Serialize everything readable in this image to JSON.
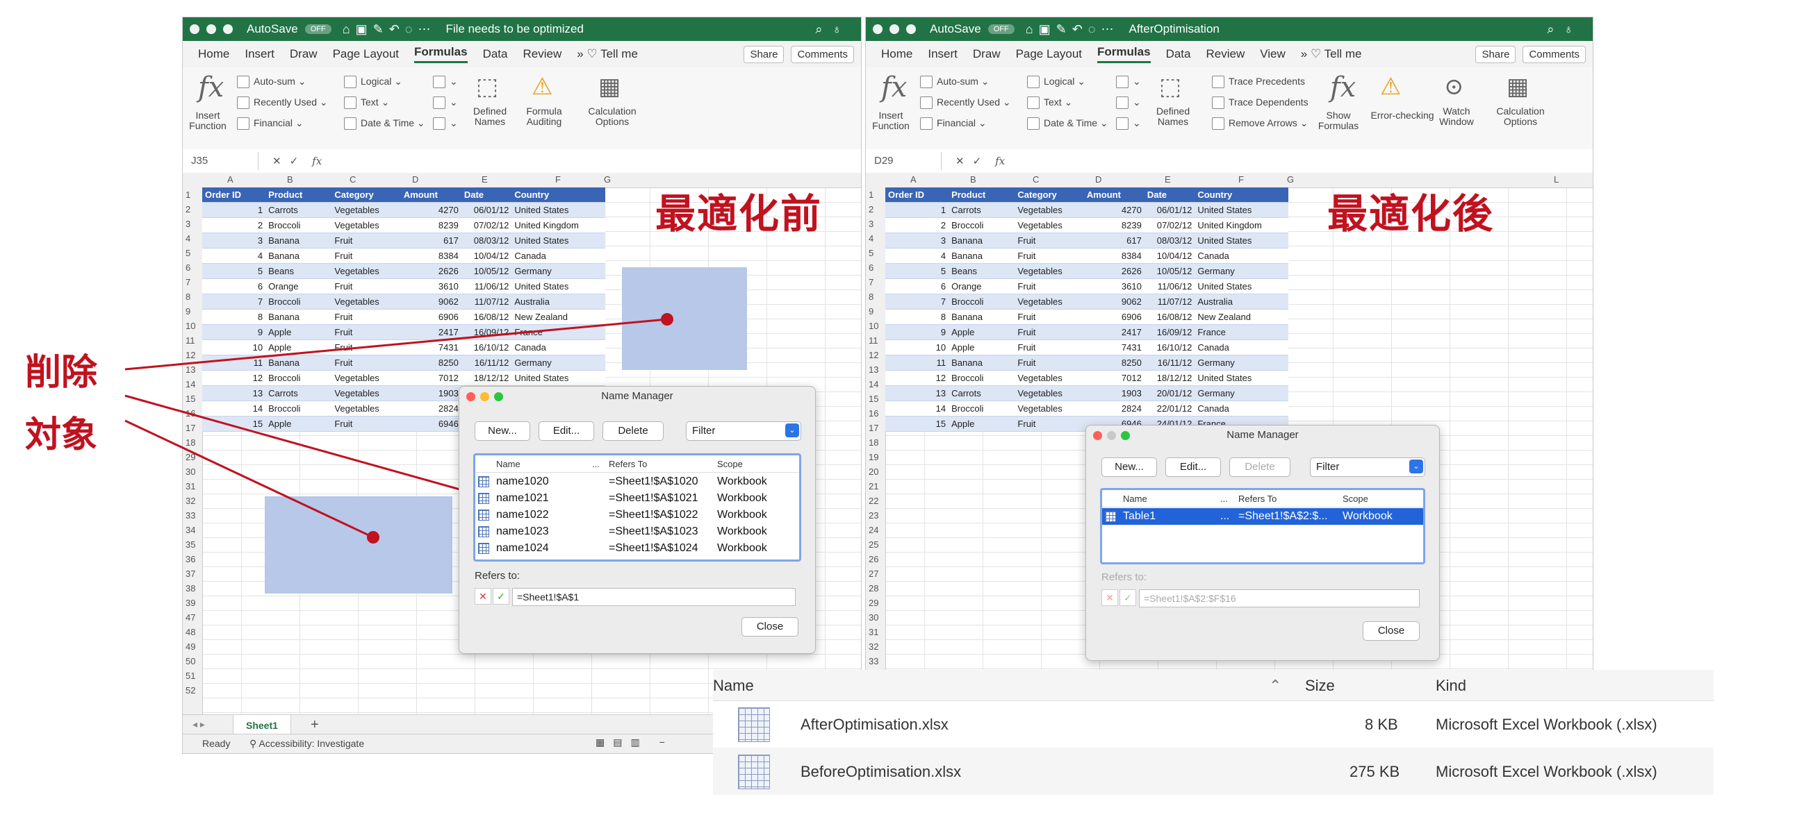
{
  "left_window": {
    "autosave_label": "AutoSave",
    "autosave_state": "OFF",
    "doc_title": "File needs to be optimized",
    "menu": [
      "Home",
      "Insert",
      "Draw",
      "Page Layout",
      "Formulas",
      "Data",
      "Review"
    ],
    "tell_me": "Tell me",
    "share": "Share",
    "comments": "Comments",
    "name_box": "J35",
    "section_label": "最適化前"
  },
  "right_window": {
    "autosave_label": "AutoSave",
    "autosave_state": "OFF",
    "doc_title": "AfterOptimisation",
    "menu": [
      "Home",
      "Insert",
      "Draw",
      "Page Layout",
      "Formulas",
      "Data",
      "Review",
      "View"
    ],
    "tell_me": "Tell me",
    "share": "Share",
    "comments": "Comments",
    "name_box": "D29",
    "section_label": "最適化後"
  },
  "ribbon": {
    "insert_function": "Insert Function",
    "autosum": "Auto-sum",
    "recently_used": "Recently Used",
    "financial": "Financial",
    "logical": "Logical",
    "text": "Text",
    "date_time": "Date & Time",
    "defined_names": "Defined Names",
    "formula_auditing": "Formula Auditing",
    "calculation_options": "Calculation Options",
    "trace_precedents": "Trace Precedents",
    "trace_dependents": "Trace Dependents",
    "remove_arrows": "Remove Arrows",
    "show_formulas": "Show Formulas",
    "error_checking": "Error-checking",
    "watch_window": "Watch Window"
  },
  "formula_fx": "fx",
  "columns": [
    "A",
    "B",
    "C",
    "D",
    "E",
    "F",
    "G"
  ],
  "right_columns_extra": "L",
  "table": {
    "headers": [
      "Order ID",
      "Product",
      "Category",
      "Amount",
      "Date",
      "Country"
    ],
    "rows": [
      [
        "1",
        "Carrots",
        "Vegetables",
        "4270",
        "06/01/12",
        "United States"
      ],
      [
        "2",
        "Broccoli",
        "Vegetables",
        "8239",
        "07/02/12",
        "United Kingdom"
      ],
      [
        "3",
        "Banana",
        "Fruit",
        "617",
        "08/03/12",
        "United States"
      ],
      [
        "4",
        "Banana",
        "Fruit",
        "8384",
        "10/04/12",
        "Canada"
      ],
      [
        "5",
        "Beans",
        "Vegetables",
        "2626",
        "10/05/12",
        "Germany"
      ],
      [
        "6",
        "Orange",
        "Fruit",
        "3610",
        "11/06/12",
        "United States"
      ],
      [
        "7",
        "Broccoli",
        "Vegetables",
        "9062",
        "11/07/12",
        "Australia"
      ],
      [
        "8",
        "Banana",
        "Fruit",
        "6906",
        "16/08/12",
        "New Zealand"
      ],
      [
        "9",
        "Apple",
        "Fruit",
        "2417",
        "16/09/12",
        "France"
      ],
      [
        "10",
        "Apple",
        "Fruit",
        "7431",
        "16/10/12",
        "Canada"
      ],
      [
        "11",
        "Banana",
        "Fruit",
        "8250",
        "16/11/12",
        "Germany"
      ],
      [
        "12",
        "Broccoli",
        "Vegetables",
        "7012",
        "18/12/12",
        "United States"
      ],
      [
        "13",
        "Carrots",
        "Vegetables",
        "1903",
        "20/01/12",
        "Germany"
      ],
      [
        "14",
        "Broccoli",
        "Vegetables",
        "2824",
        "22/01/12",
        "Canada"
      ],
      [
        "15",
        "Apple",
        "Fruit",
        "6946",
        "24/01/12",
        "France"
      ]
    ]
  },
  "left_row_numbers": [
    "1",
    "2",
    "3",
    "4",
    "5",
    "6",
    "7",
    "8",
    "9",
    "10",
    "11",
    "12",
    "13",
    "14",
    "15",
    "16",
    "17",
    "18",
    "29",
    "30",
    "31",
    "32",
    "33",
    "34",
    "35",
    "36",
    "37",
    "38",
    "39",
    "47",
    "48",
    "49",
    "50",
    "51",
    "52"
  ],
  "right_row_numbers": [
    "1",
    "2",
    "3",
    "4",
    "5",
    "6",
    "7",
    "8",
    "9",
    "10",
    "11",
    "12",
    "13",
    "14",
    "15",
    "16",
    "17",
    "18",
    "19",
    "20",
    "21",
    "22",
    "23",
    "24",
    "25",
    "26",
    "27",
    "28",
    "29",
    "30",
    "31",
    "32",
    "33"
  ],
  "left_annotation": [
    "削除",
    "対象"
  ],
  "name_manager_before": {
    "title": "Name Manager",
    "buttons": {
      "new": "New...",
      "edit": "Edit...",
      "delete": "Delete",
      "filter": "Filter"
    },
    "columns": {
      "name": "Name",
      "dots": "...",
      "refers": "Refers To",
      "scope": "Scope"
    },
    "rows": [
      {
        "name": "name1020",
        "refers": "=Sheet1!$A$1020",
        "scope": "Workbook"
      },
      {
        "name": "name1021",
        "refers": "=Sheet1!$A$1021",
        "scope": "Workbook"
      },
      {
        "name": "name1022",
        "refers": "=Sheet1!$A$1022",
        "scope": "Workbook"
      },
      {
        "name": "name1023",
        "refers": "=Sheet1!$A$1023",
        "scope": "Workbook"
      },
      {
        "name": "name1024",
        "refers": "=Sheet1!$A$1024",
        "scope": "Workbook"
      }
    ],
    "refers_to_label": "Refers to:",
    "refers_to_value": "=Sheet1!$A$1",
    "close": "Close"
  },
  "name_manager_after": {
    "title": "Name Manager",
    "buttons": {
      "new": "New...",
      "edit": "Edit...",
      "delete": "Delete",
      "filter": "Filter"
    },
    "columns": {
      "name": "Name",
      "dots": "...",
      "refers": "Refers To",
      "scope": "Scope"
    },
    "rows": [
      {
        "name": "Table1",
        "dots": "...",
        "refers": "=Sheet1!$A$2:$...",
        "scope": "Workbook"
      }
    ],
    "refers_to_label": "Refers to:",
    "refers_to_value": "=Sheet1!$A$2:$F$16",
    "close": "Close"
  },
  "sheet_tab": "Sheet1",
  "status": {
    "ready": "Ready",
    "accessibility": "Accessibility: Investigate"
  },
  "finder": {
    "columns": {
      "name": "Name",
      "size": "Size",
      "kind": "Kind"
    },
    "files": [
      {
        "name": "AfterOptimisation.xlsx",
        "size": "8 KB",
        "kind": "Microsoft Excel Workbook (.xlsx)"
      },
      {
        "name": "BeforeOptimisation.xlsx",
        "size": "275 KB",
        "kind": "Microsoft Excel Workbook (.xlsx)"
      }
    ]
  },
  "colors": {
    "excel_green": "#217346",
    "table_header": "#3a65b5",
    "annotation_red": "#c0121f",
    "highlight": "#b7c8e8"
  }
}
